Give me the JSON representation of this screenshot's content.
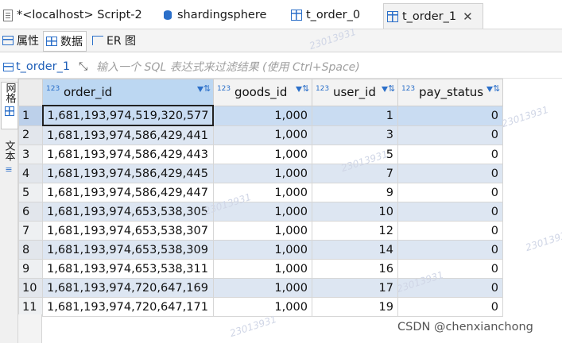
{
  "tabs": [
    {
      "label": "*<localhost> Script-2",
      "icon": "script-icon"
    },
    {
      "label": "shardingsphere",
      "icon": "database-icon"
    },
    {
      "label": "t_order_0",
      "icon": "table-icon"
    },
    {
      "label": "t_order_1",
      "icon": "table-icon",
      "active": true
    }
  ],
  "close_symbol": "✕",
  "subtabs": [
    {
      "label": "属性",
      "icon": "properties-icon"
    },
    {
      "label": "数据",
      "icon": "data-icon",
      "active": true
    },
    {
      "label": "ER 图",
      "icon": "er-diagram-icon"
    }
  ],
  "filter": {
    "table_name": "t_order_1",
    "placeholder": "输入一个 SQL 表达式来过滤结果 (使用 Ctrl+Space)"
  },
  "side_tabs": {
    "grid": "网格",
    "text": "文本"
  },
  "grid": {
    "type_badge": "123",
    "columns": [
      "order_id",
      "goods_id",
      "user_id",
      "pay_status"
    ],
    "rows": [
      [
        "1",
        "1,681,193,974,519,320,577",
        "1,000",
        "1",
        "0"
      ],
      [
        "2",
        "1,681,193,974,586,429,441",
        "1,000",
        "3",
        "0"
      ],
      [
        "3",
        "1,681,193,974,586,429,443",
        "1,000",
        "5",
        "0"
      ],
      [
        "4",
        "1,681,193,974,586,429,445",
        "1,000",
        "7",
        "0"
      ],
      [
        "5",
        "1,681,193,974,586,429,447",
        "1,000",
        "9",
        "0"
      ],
      [
        "6",
        "1,681,193,974,653,538,305",
        "1,000",
        "10",
        "0"
      ],
      [
        "7",
        "1,681,193,974,653,538,307",
        "1,000",
        "12",
        "0"
      ],
      [
        "8",
        "1,681,193,974,653,538,309",
        "1,000",
        "14",
        "0"
      ],
      [
        "9",
        "1,681,193,974,653,538,311",
        "1,000",
        "16",
        "0"
      ],
      [
        "10",
        "1,681,193,974,720,647,169",
        "1,000",
        "17",
        "0"
      ],
      [
        "11",
        "1,681,193,974,720,647,171",
        "1,000",
        "19",
        "0"
      ]
    ]
  },
  "watermark": "23013931",
  "credit": "CSDN @chenxianchong",
  "colors": {
    "accent": "#2b6fc9",
    "row_alt": "#dde6f2",
    "header_sorted": "#bcd7f2"
  }
}
